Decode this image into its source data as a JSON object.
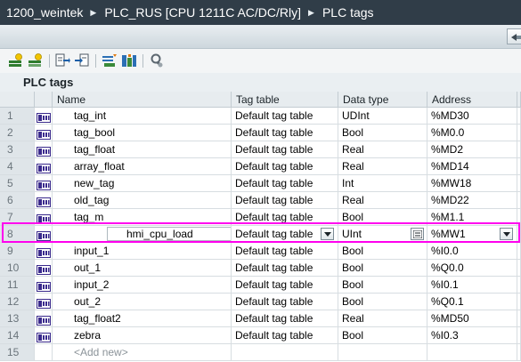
{
  "breadcrumb": [
    "1200_weintek",
    "PLC_RUS [CPU 1211C AC/DC/Rly]",
    "PLC tags"
  ],
  "breadcrumb_separator": "▶",
  "toolbar": {
    "icons": [
      "add-tag-icon",
      "insert-tag-icon",
      "export-icon",
      "import-icon",
      "monitor-icon",
      "monitor-all-icon",
      "filter-icon"
    ]
  },
  "section_title": "PLC tags",
  "table": {
    "columns": [
      "",
      "",
      "Name",
      "Tag table",
      "Data type",
      "Address"
    ],
    "rows": [
      {
        "num": "1",
        "name": "tag_int",
        "table": "Default tag table",
        "type": "UDInt",
        "address": "%MD30"
      },
      {
        "num": "2",
        "name": "tag_bool",
        "table": "Default tag table",
        "type": "Bool",
        "address": "%M0.0"
      },
      {
        "num": "3",
        "name": "tag_float",
        "table": "Default tag table",
        "type": "Real",
        "address": "%MD2"
      },
      {
        "num": "4",
        "name": "array_float",
        "table": "Default tag table",
        "type": "Real",
        "address": "%MD14"
      },
      {
        "num": "5",
        "name": "new_tag",
        "table": "Default tag table",
        "type": "Int",
        "address": "%MW18"
      },
      {
        "num": "6",
        "name": "old_tag",
        "table": "Default tag table",
        "type": "Real",
        "address": "%MD22"
      },
      {
        "num": "7",
        "name": "tag_m",
        "table": "Default tag table",
        "type": "Bool",
        "address": "%M1.1"
      },
      {
        "num": "8",
        "name": "hmi_cpu_load",
        "table": "Default tag table",
        "type": "UInt",
        "address": "%MW1"
      },
      {
        "num": "9",
        "name": "input_1",
        "table": "Default tag table",
        "type": "Bool",
        "address": "%I0.0"
      },
      {
        "num": "10",
        "name": "out_1",
        "table": "Default tag table",
        "type": "Bool",
        "address": "%Q0.0"
      },
      {
        "num": "11",
        "name": "input_2",
        "table": "Default tag table",
        "type": "Bool",
        "address": "%I0.1"
      },
      {
        "num": "12",
        "name": "out_2",
        "table": "Default tag table",
        "type": "Bool",
        "address": "%Q0.1"
      },
      {
        "num": "13",
        "name": "tag_float2",
        "table": "Default tag table",
        "type": "Real",
        "address": "%MD50"
      },
      {
        "num": "14",
        "name": "zebra",
        "table": "Default tag table",
        "type": "Bool",
        "address": "%I0.3"
      }
    ],
    "add_row": {
      "num": "15",
      "placeholder": "<Add new>"
    }
  },
  "colors": {
    "title_bar": "#303d48",
    "selection_frame": "#ff00ee",
    "tag_icon": "#3a2a8c"
  }
}
